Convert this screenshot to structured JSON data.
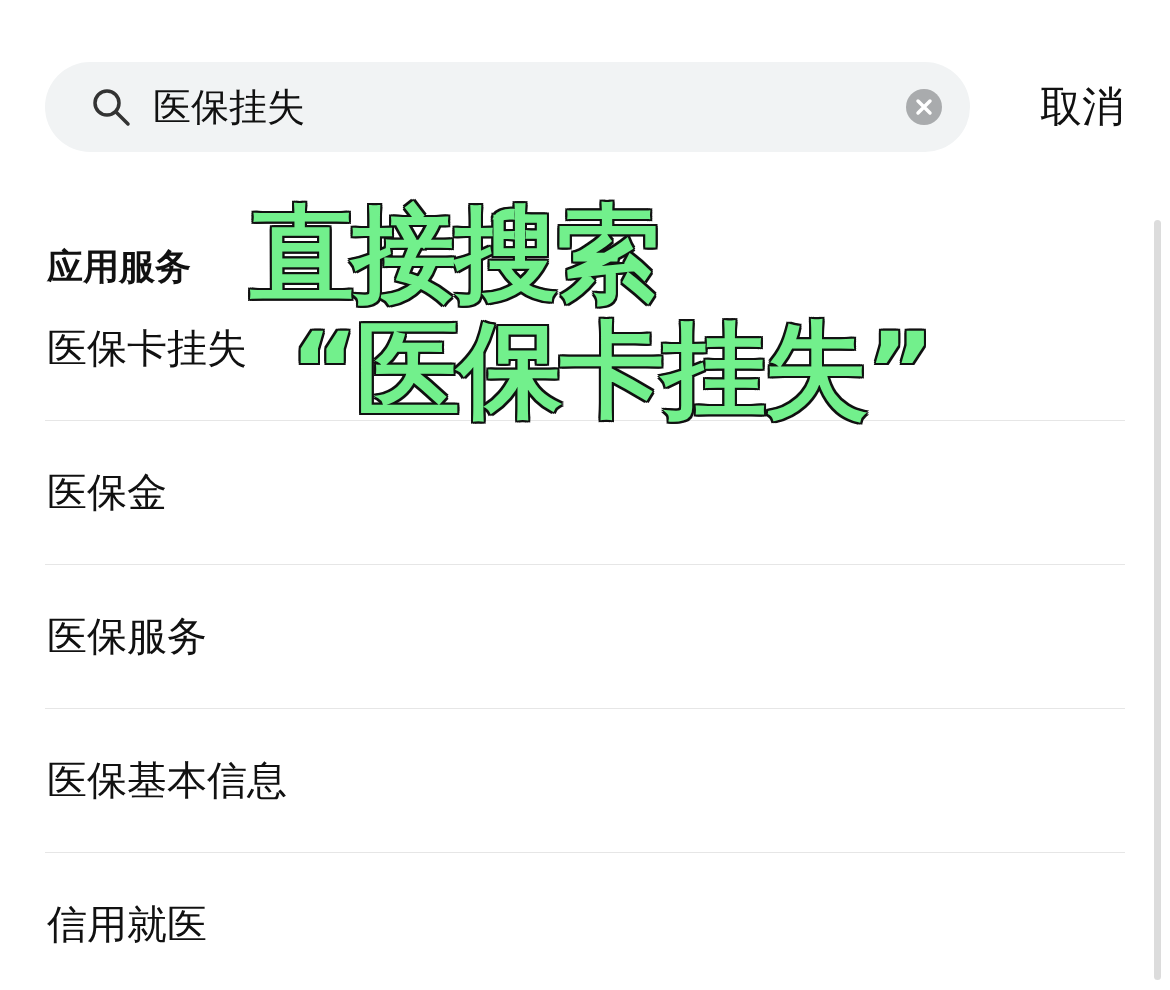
{
  "search": {
    "value": "医保挂失"
  },
  "cancel_button": "取消",
  "section": {
    "title": "应用服务",
    "items": [
      {
        "label": "医保卡挂失"
      },
      {
        "label": "医保金"
      },
      {
        "label": "医保服务"
      },
      {
        "label": "医保基本信息"
      },
      {
        "label": "信用就医"
      }
    ]
  },
  "annotation": {
    "lines": [
      "直接搜索",
      "“医保卡挂失”"
    ]
  }
}
